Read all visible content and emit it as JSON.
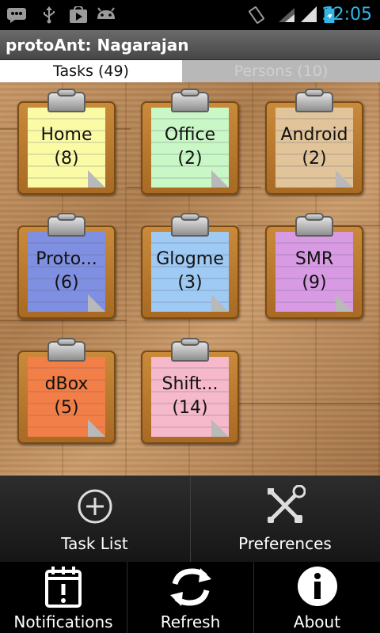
{
  "status_bar": {
    "time": "22:05",
    "left_icons": [
      "message-icon",
      "usb-icon",
      "play-store-icon",
      "android-debug-icon"
    ],
    "right_icons": [
      "screen-rotate-icon",
      "wifi-signal-icon",
      "cell-signal-icon",
      "battery-charging-icon"
    ],
    "time_color": "#33b5e5"
  },
  "app_bar": {
    "title": "protoAnt: Nagarajan"
  },
  "tabs": [
    {
      "label": "Tasks (49)",
      "selected": true
    },
    {
      "label": "Persons (10)",
      "selected": false
    }
  ],
  "clipboards": [
    {
      "name": "Home",
      "count": "(8)",
      "color": "#fbfba6"
    },
    {
      "name": "Office",
      "count": "(2)",
      "color": "#c9f7c6"
    },
    {
      "name": "Android",
      "count": "(2)",
      "color": "#e1c499"
    },
    {
      "name": "Proto...",
      "count": "(6)",
      "color": "#7f8fe1"
    },
    {
      "name": "Glogme",
      "count": "(3)",
      "color": "#9ecaf3"
    },
    {
      "name": "SMR",
      "count": "(9)",
      "color": "#d89be3"
    },
    {
      "name": "dBox",
      "count": "(5)",
      "color": "#f27f47"
    },
    {
      "name": "Shift...",
      "count": "(14)",
      "color": "#f6b9cb"
    }
  ],
  "actions": {
    "task_list": {
      "label": "Task List",
      "icon": "add-circle-icon"
    },
    "preferences": {
      "label": "Preferences",
      "icon": "tools-icon"
    }
  },
  "menu": {
    "notifications": {
      "label": "Notifications",
      "icon": "calendar-alert-icon"
    },
    "refresh": {
      "label": "Refresh",
      "icon": "refresh-icon"
    },
    "about": {
      "label": "About",
      "icon": "info-icon"
    }
  }
}
